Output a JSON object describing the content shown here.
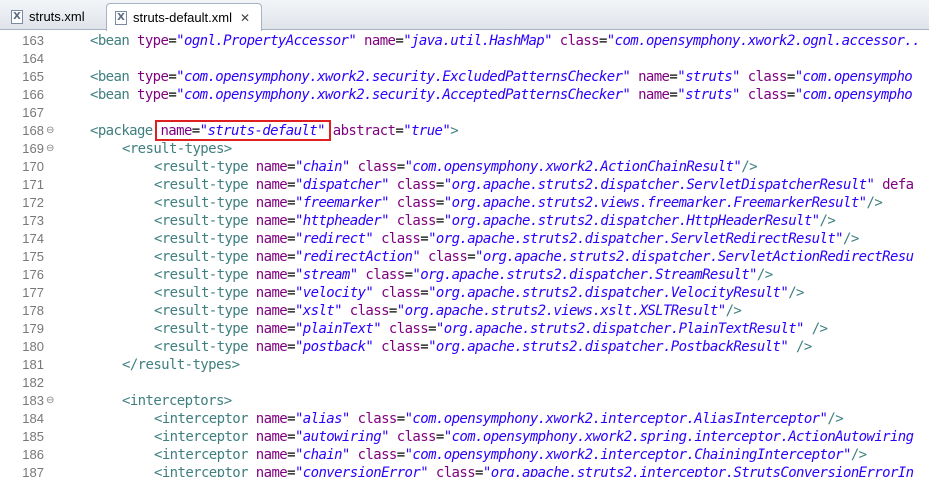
{
  "tabs": [
    {
      "label": "struts.xml",
      "icon": "xml-file-icon",
      "active": false
    },
    {
      "label": "struts-default.xml",
      "icon": "xml-file-icon",
      "active": true
    }
  ],
  "highlight_line": 168,
  "colors": {
    "tag": "#3f7f7f",
    "attr": "#7f007f",
    "value": "#2a00ff",
    "line_number": "#787878",
    "highlight_border": "#e02020"
  },
  "lines": [
    {
      "num": "163",
      "fold": "",
      "indent": 1,
      "parts": [
        [
          "tag",
          "<bean"
        ],
        [
          "attr",
          " type"
        ],
        [
          "eq",
          "="
        ],
        [
          "val",
          "\"ognl.PropertyAccessor\""
        ],
        [
          "attr",
          " name"
        ],
        [
          "eq",
          "="
        ],
        [
          "val",
          "\"java.util.HashMap\""
        ],
        [
          "attr",
          " class"
        ],
        [
          "eq",
          "="
        ],
        [
          "val",
          "\"com.opensymphony.xwork2.ognl.accessor.."
        ]
      ]
    },
    {
      "num": "164",
      "fold": "",
      "indent": 0,
      "parts": []
    },
    {
      "num": "165",
      "fold": "",
      "indent": 1,
      "parts": [
        [
          "tag",
          "<bean"
        ],
        [
          "attr",
          " type"
        ],
        [
          "eq",
          "="
        ],
        [
          "val",
          "\"com.opensymphony.xwork2.security.ExcludedPatternsChecker\""
        ],
        [
          "attr",
          " name"
        ],
        [
          "eq",
          "="
        ],
        [
          "val",
          "\"struts\""
        ],
        [
          "attr",
          " class"
        ],
        [
          "eq",
          "="
        ],
        [
          "val",
          "\"com.opensympho"
        ]
      ]
    },
    {
      "num": "166",
      "fold": "",
      "indent": 1,
      "parts": [
        [
          "tag",
          "<bean"
        ],
        [
          "attr",
          " type"
        ],
        [
          "eq",
          "="
        ],
        [
          "val",
          "\"com.opensymphony.xwork2.security.AcceptedPatternsChecker\""
        ],
        [
          "attr",
          " name"
        ],
        [
          "eq",
          "="
        ],
        [
          "val",
          "\"struts\""
        ],
        [
          "attr",
          " class"
        ],
        [
          "eq",
          "="
        ],
        [
          "val",
          "\"com.opensympho"
        ]
      ]
    },
    {
      "num": "167",
      "fold": "",
      "indent": 0,
      "parts": []
    },
    {
      "num": "168",
      "fold": "⊖",
      "indent": 1,
      "parts": [
        [
          "tag",
          "<package"
        ],
        [
          "attr",
          " name"
        ],
        [
          "eq",
          "="
        ],
        [
          "val",
          "\"struts-default\""
        ],
        [
          "attr",
          " abstract"
        ],
        [
          "eq",
          "="
        ],
        [
          "val",
          "\"true\""
        ],
        [
          "tag",
          ">"
        ]
      ]
    },
    {
      "num": "169",
      "fold": "⊖",
      "indent": 2,
      "parts": [
        [
          "tag",
          "<result-types>"
        ]
      ]
    },
    {
      "num": "170",
      "fold": "",
      "indent": 3,
      "parts": [
        [
          "tag",
          "<result-type"
        ],
        [
          "attr",
          " name"
        ],
        [
          "eq",
          "="
        ],
        [
          "val",
          "\"chain\""
        ],
        [
          "attr",
          " class"
        ],
        [
          "eq",
          "="
        ],
        [
          "val",
          "\"com.opensymphony.xwork2.ActionChainResult\""
        ],
        [
          "tag",
          "/>"
        ]
      ]
    },
    {
      "num": "171",
      "fold": "",
      "indent": 3,
      "parts": [
        [
          "tag",
          "<result-type"
        ],
        [
          "attr",
          " name"
        ],
        [
          "eq",
          "="
        ],
        [
          "val",
          "\"dispatcher\""
        ],
        [
          "attr",
          " class"
        ],
        [
          "eq",
          "="
        ],
        [
          "val",
          "\"org.apache.struts2.dispatcher.ServletDispatcherResult\""
        ],
        [
          "attr",
          " defa"
        ]
      ]
    },
    {
      "num": "172",
      "fold": "",
      "indent": 3,
      "parts": [
        [
          "tag",
          "<result-type"
        ],
        [
          "attr",
          " name"
        ],
        [
          "eq",
          "="
        ],
        [
          "val",
          "\"freemarker\""
        ],
        [
          "attr",
          " class"
        ],
        [
          "eq",
          "="
        ],
        [
          "val",
          "\"org.apache.struts2.views.freemarker.FreemarkerResult\""
        ],
        [
          "tag",
          "/>"
        ]
      ]
    },
    {
      "num": "173",
      "fold": "",
      "indent": 3,
      "parts": [
        [
          "tag",
          "<result-type"
        ],
        [
          "attr",
          " name"
        ],
        [
          "eq",
          "="
        ],
        [
          "val",
          "\"httpheader\""
        ],
        [
          "attr",
          " class"
        ],
        [
          "eq",
          "="
        ],
        [
          "val",
          "\"org.apache.struts2.dispatcher.HttpHeaderResult\""
        ],
        [
          "tag",
          "/>"
        ]
      ]
    },
    {
      "num": "174",
      "fold": "",
      "indent": 3,
      "parts": [
        [
          "tag",
          "<result-type"
        ],
        [
          "attr",
          " name"
        ],
        [
          "eq",
          "="
        ],
        [
          "val",
          "\"redirect\""
        ],
        [
          "attr",
          " class"
        ],
        [
          "eq",
          "="
        ],
        [
          "val",
          "\"org.apache.struts2.dispatcher.ServletRedirectResult\""
        ],
        [
          "tag",
          "/>"
        ]
      ]
    },
    {
      "num": "175",
      "fold": "",
      "indent": 3,
      "parts": [
        [
          "tag",
          "<result-type"
        ],
        [
          "attr",
          " name"
        ],
        [
          "eq",
          "="
        ],
        [
          "val",
          "\"redirectAction\""
        ],
        [
          "attr",
          " class"
        ],
        [
          "eq",
          "="
        ],
        [
          "val",
          "\"org.apache.struts2.dispatcher.ServletActionRedirectResu"
        ]
      ]
    },
    {
      "num": "176",
      "fold": "",
      "indent": 3,
      "parts": [
        [
          "tag",
          "<result-type"
        ],
        [
          "attr",
          " name"
        ],
        [
          "eq",
          "="
        ],
        [
          "val",
          "\"stream\""
        ],
        [
          "attr",
          " class"
        ],
        [
          "eq",
          "="
        ],
        [
          "val",
          "\"org.apache.struts2.dispatcher.StreamResult\""
        ],
        [
          "tag",
          "/>"
        ]
      ]
    },
    {
      "num": "177",
      "fold": "",
      "indent": 3,
      "parts": [
        [
          "tag",
          "<result-type"
        ],
        [
          "attr",
          " name"
        ],
        [
          "eq",
          "="
        ],
        [
          "val",
          "\"velocity\""
        ],
        [
          "attr",
          " class"
        ],
        [
          "eq",
          "="
        ],
        [
          "val",
          "\"org.apache.struts2.dispatcher.VelocityResult\""
        ],
        [
          "tag",
          "/>"
        ]
      ]
    },
    {
      "num": "178",
      "fold": "",
      "indent": 3,
      "parts": [
        [
          "tag",
          "<result-type"
        ],
        [
          "attr",
          " name"
        ],
        [
          "eq",
          "="
        ],
        [
          "val",
          "\"xslt\""
        ],
        [
          "attr",
          " class"
        ],
        [
          "eq",
          "="
        ],
        [
          "val",
          "\"org.apache.struts2.views.xslt.XSLTResult\""
        ],
        [
          "tag",
          "/>"
        ]
      ]
    },
    {
      "num": "179",
      "fold": "",
      "indent": 3,
      "parts": [
        [
          "tag",
          "<result-type"
        ],
        [
          "attr",
          " name"
        ],
        [
          "eq",
          "="
        ],
        [
          "val",
          "\"plainText\""
        ],
        [
          "attr",
          " class"
        ],
        [
          "eq",
          "="
        ],
        [
          "val",
          "\"org.apache.struts2.dispatcher.PlainTextResult\""
        ],
        [
          "tag",
          " />"
        ]
      ]
    },
    {
      "num": "180",
      "fold": "",
      "indent": 3,
      "parts": [
        [
          "tag",
          "<result-type"
        ],
        [
          "attr",
          " name"
        ],
        [
          "eq",
          "="
        ],
        [
          "val",
          "\"postback\""
        ],
        [
          "attr",
          " class"
        ],
        [
          "eq",
          "="
        ],
        [
          "val",
          "\"org.apache.struts2.dispatcher.PostbackResult\""
        ],
        [
          "tag",
          " />"
        ]
      ]
    },
    {
      "num": "181",
      "fold": "",
      "indent": 2,
      "parts": [
        [
          "tag",
          "</result-types>"
        ]
      ]
    },
    {
      "num": "182",
      "fold": "",
      "indent": 0,
      "parts": []
    },
    {
      "num": "183",
      "fold": "⊖",
      "indent": 2,
      "parts": [
        [
          "tag",
          "<interceptors>"
        ]
      ]
    },
    {
      "num": "184",
      "fold": "",
      "indent": 3,
      "parts": [
        [
          "tag",
          "<interceptor"
        ],
        [
          "attr",
          " name"
        ],
        [
          "eq",
          "="
        ],
        [
          "val",
          "\"alias\""
        ],
        [
          "attr",
          " class"
        ],
        [
          "eq",
          "="
        ],
        [
          "val",
          "\"com.opensymphony.xwork2.interceptor.AliasInterceptor\""
        ],
        [
          "tag",
          "/>"
        ]
      ]
    },
    {
      "num": "185",
      "fold": "",
      "indent": 3,
      "parts": [
        [
          "tag",
          "<interceptor"
        ],
        [
          "attr",
          " name"
        ],
        [
          "eq",
          "="
        ],
        [
          "val",
          "\"autowiring\""
        ],
        [
          "attr",
          " class"
        ],
        [
          "eq",
          "="
        ],
        [
          "val",
          "\"com.opensymphony.xwork2.spring.interceptor.ActionAutowiring"
        ]
      ]
    },
    {
      "num": "186",
      "fold": "",
      "indent": 3,
      "parts": [
        [
          "tag",
          "<interceptor"
        ],
        [
          "attr",
          " name"
        ],
        [
          "eq",
          "="
        ],
        [
          "val",
          "\"chain\""
        ],
        [
          "attr",
          " class"
        ],
        [
          "eq",
          "="
        ],
        [
          "val",
          "\"com.opensymphony.xwork2.interceptor.ChainingInterceptor\""
        ],
        [
          "tag",
          "/>"
        ]
      ]
    },
    {
      "num": "187",
      "fold": "",
      "indent": 3,
      "parts": [
        [
          "tag",
          "<interceptor"
        ],
        [
          "attr",
          " name"
        ],
        [
          "eq",
          "="
        ],
        [
          "val",
          "\"conversionError\""
        ],
        [
          "attr",
          " class"
        ],
        [
          "eq",
          "="
        ],
        [
          "val",
          "\"org.apache.struts2.interceptor.StrutsConversionErrorIn"
        ]
      ]
    }
  ]
}
